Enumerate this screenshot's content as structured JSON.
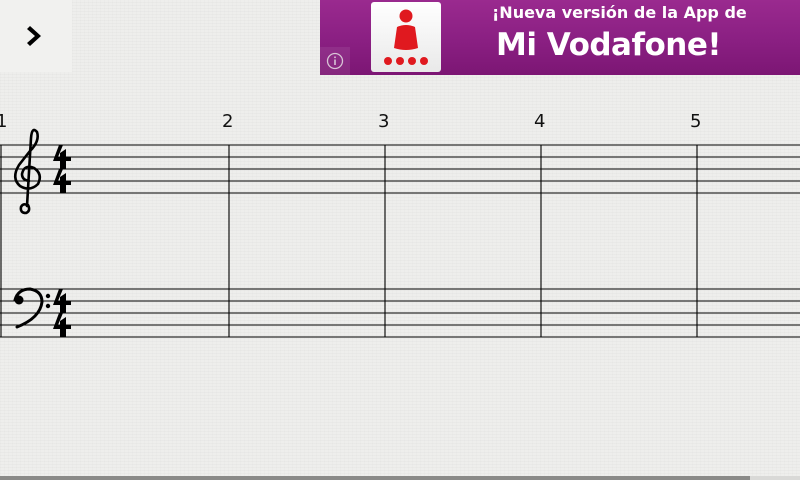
{
  "toolbar": {
    "next_icon": "chevron-right-icon"
  },
  "ad": {
    "headline": "¡Nueva versión de la App de",
    "brand": "Mi Vodafone!",
    "info_icon": "info-icon",
    "logo_icon": "mi-vodafone-app-icon",
    "colors": {
      "background": "#8a1f82",
      "logo_red": "#e0191f"
    }
  },
  "score": {
    "measure_numbers": [
      "1",
      "2",
      "3",
      "4",
      "5"
    ],
    "treble_staff": {
      "clef": "treble-clef-icon",
      "time_signature": {
        "top": "4",
        "bottom": "4"
      }
    },
    "bass_staff": {
      "clef": "bass-clef-icon",
      "time_signature": {
        "top": "4",
        "bottom": "4"
      }
    }
  }
}
